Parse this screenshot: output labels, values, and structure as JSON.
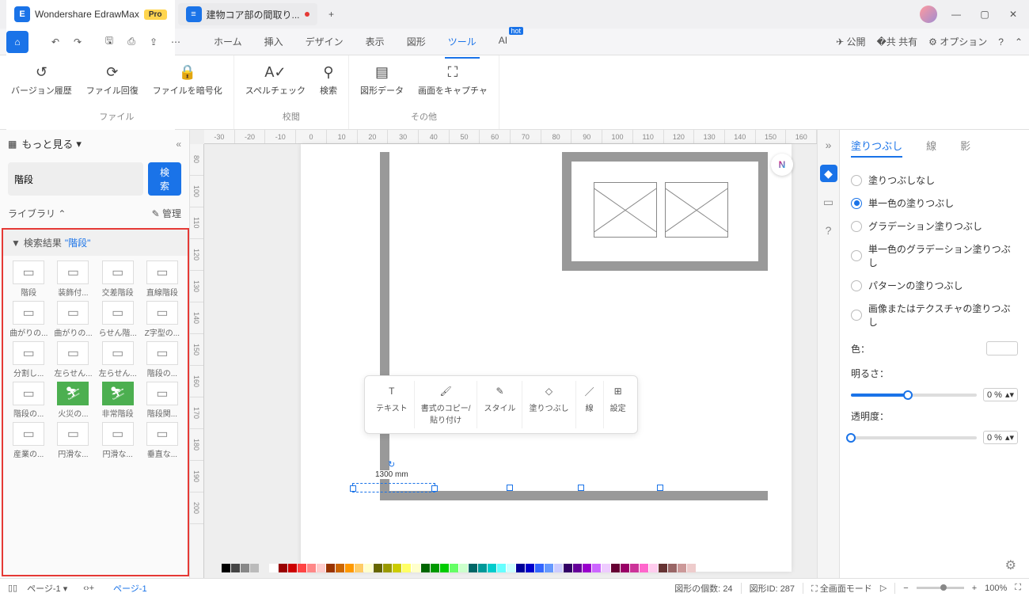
{
  "app": {
    "name": "Wondershare EdrawMax",
    "badge": "Pro",
    "doc_title": "建物コア部の間取り..."
  },
  "menu": {
    "home": "ホーム",
    "insert": "挿入",
    "design": "デザイン",
    "view": "表示",
    "shape": "図形",
    "tool": "ツール",
    "ai": "AI",
    "ai_badge": "hot"
  },
  "toolbar_right": {
    "publish": "公開",
    "share": "共有",
    "options": "オプション"
  },
  "ribbon": {
    "version_history": "バージョン履歴",
    "file_recover": "ファイル回復",
    "encrypt": "ファイルを暗号化",
    "spellcheck": "スペルチェック",
    "search": "検索",
    "shape_data": "図形データ",
    "capture": "画面をキャプチャ",
    "group_file": "ファイル",
    "group_review": "校閲",
    "group_other": "その他"
  },
  "left": {
    "more": "もっと見る",
    "search_value": "階段",
    "search_btn": "検索",
    "library": "ライブラリ",
    "manage": "管理",
    "results_prefix": "検索結果",
    "results_keyword": "\"階段\"",
    "shapes": [
      "階段",
      "装飾付...",
      "交差階段",
      "直線階段",
      "曲がりの...",
      "曲がりの...",
      "らせん階...",
      "Z字型の...",
      "分割し...",
      "左らせん...",
      "左らせん...",
      "階段の...",
      "階段の...",
      "火災の...",
      "非常階段",
      "階段関...",
      "産業の...",
      "円滑な...",
      "円滑な...",
      "垂直な..."
    ]
  },
  "ruler_h": [
    "-30",
    "-20",
    "-10",
    "0",
    "10",
    "20",
    "30",
    "40",
    "50",
    "60",
    "70",
    "80",
    "90",
    "100",
    "110",
    "120",
    "130",
    "140",
    "150",
    "160"
  ],
  "ruler_v": [
    "80",
    "100",
    "110",
    "120",
    "130",
    "140",
    "150",
    "160",
    "170",
    "180",
    "190",
    "200"
  ],
  "canvas": {
    "dimension": "1300 mm"
  },
  "float_toolbar": {
    "text": "テキスト",
    "format_copy": "書式のコピー/\n貼り付け",
    "style": "スタイル",
    "fill": "塗りつぶし",
    "line": "線",
    "settings": "設定"
  },
  "right": {
    "tabs": {
      "fill": "塗りつぶし",
      "line": "線",
      "shadow": "影"
    },
    "fill_none": "塗りつぶしなし",
    "fill_solid": "単一色の塗りつぶし",
    "fill_gradient": "グラデーション塗りつぶし",
    "fill_solid_grad": "単一色のグラデーション塗りつぶし",
    "fill_pattern": "パターンの塗りつぶし",
    "fill_image": "画像またはテクスチャの塗りつぶし",
    "color": "色：",
    "brightness": "明るさ：",
    "brightness_val": "0 %",
    "transparency": "透明度：",
    "transparency_val": "0 %"
  },
  "status": {
    "page_tab": "ページ-1",
    "page_active": "ページ-1",
    "shape_count_label": "図形の個数:",
    "shape_count": "24",
    "shape_id_label": "図形ID:",
    "shape_id": "287",
    "fullscreen": "全画面モード",
    "zoom": "100%"
  },
  "palette_colors": [
    "#000",
    "#444",
    "#888",
    "#bbb",
    "#eee",
    "#fff",
    "#900",
    "#c00",
    "#f44",
    "#f88",
    "#fcc",
    "#930",
    "#c60",
    "#f90",
    "#fc6",
    "#ffc",
    "#660",
    "#990",
    "#cc0",
    "#ff6",
    "#ffc",
    "#060",
    "#090",
    "#0c0",
    "#6f6",
    "#cfc",
    "#066",
    "#099",
    "#0cc",
    "#6ff",
    "#cff",
    "#009",
    "#00c",
    "#36f",
    "#69f",
    "#ccf",
    "#306",
    "#609",
    "#90c",
    "#c6f",
    "#ecf",
    "#603",
    "#906",
    "#c39",
    "#f6c",
    "#fce",
    "#633",
    "#966",
    "#c99",
    "#ecc"
  ]
}
